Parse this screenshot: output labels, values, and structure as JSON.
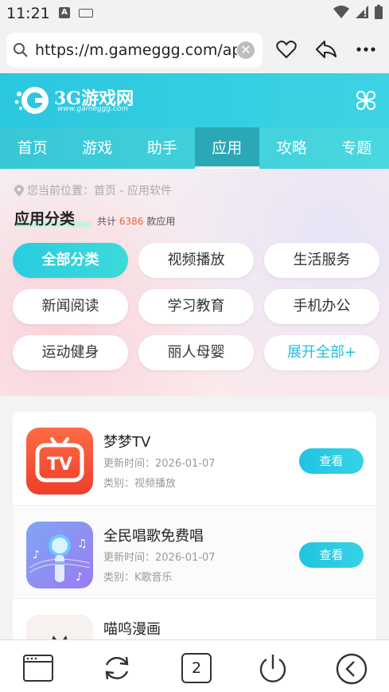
{
  "status_bar": {
    "time": "11:21",
    "notif_a": "A"
  },
  "browser": {
    "url": "https://m.gameggg.com/app/"
  },
  "site": {
    "logo_text": "3G游戏网",
    "logo_sub": "www.gameggg.com"
  },
  "nav": {
    "tabs": [
      "首页",
      "游戏",
      "助手",
      "应用",
      "攻略",
      "专题"
    ],
    "active_index": 3
  },
  "category": {
    "breadcrumb": "您当前位置：首页 - 应用软件",
    "title": "应用分类",
    "count_prefix": "共计",
    "count": "6386",
    "count_suffix": "款应用",
    "buttons": [
      "全部分类",
      "视频播放",
      "生活服务",
      "新闻阅读",
      "学习教育",
      "手机办公",
      "运动健身",
      "丽人母婴",
      "展开全部+"
    ]
  },
  "apps": [
    {
      "name": "梦梦TV",
      "update": "更新时间：2026-01-07",
      "type": "类别：视频播放",
      "button": "查看",
      "icon_text": "TV"
    },
    {
      "name": "全民唱歌免费唱",
      "update": "更新时间：2026-01-07",
      "type": "类别：K歌音乐",
      "button": "查看"
    },
    {
      "name": "喵呜漫画"
    }
  ],
  "bottom_bar": {
    "tab_count": "2"
  },
  "colors": {
    "accent": "#2bc7df",
    "count_highlight": "#f0603d",
    "tv_icon": "#f2553a"
  }
}
